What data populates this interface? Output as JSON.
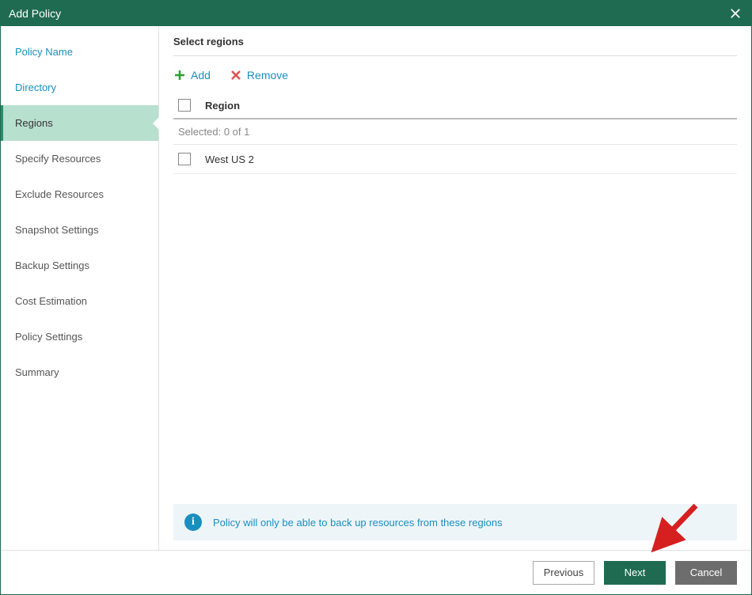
{
  "dialog": {
    "title": "Add Policy"
  },
  "sidebar": {
    "items": [
      {
        "label": "Policy Name",
        "link": true,
        "active": false
      },
      {
        "label": "Directory",
        "link": true,
        "active": false
      },
      {
        "label": "Regions",
        "link": false,
        "active": true
      },
      {
        "label": "Specify Resources",
        "link": false,
        "active": false
      },
      {
        "label": "Exclude Resources",
        "link": false,
        "active": false
      },
      {
        "label": "Snapshot Settings",
        "link": false,
        "active": false
      },
      {
        "label": "Backup Settings",
        "link": false,
        "active": false
      },
      {
        "label": "Cost Estimation",
        "link": false,
        "active": false
      },
      {
        "label": "Policy Settings",
        "link": false,
        "active": false
      },
      {
        "label": "Summary",
        "link": false,
        "active": false
      }
    ]
  },
  "main": {
    "heading": "Select regions",
    "toolbar": {
      "add_label": "Add",
      "remove_label": "Remove"
    },
    "table": {
      "column_header": "Region",
      "selected_label": "Selected:",
      "selected_value": "0 of 1",
      "rows": [
        {
          "name": "West US 2",
          "checked": false
        }
      ]
    },
    "info_text": "Policy will only be able to back up resources from these regions"
  },
  "footer": {
    "previous": "Previous",
    "next": "Next",
    "cancel": "Cancel"
  }
}
